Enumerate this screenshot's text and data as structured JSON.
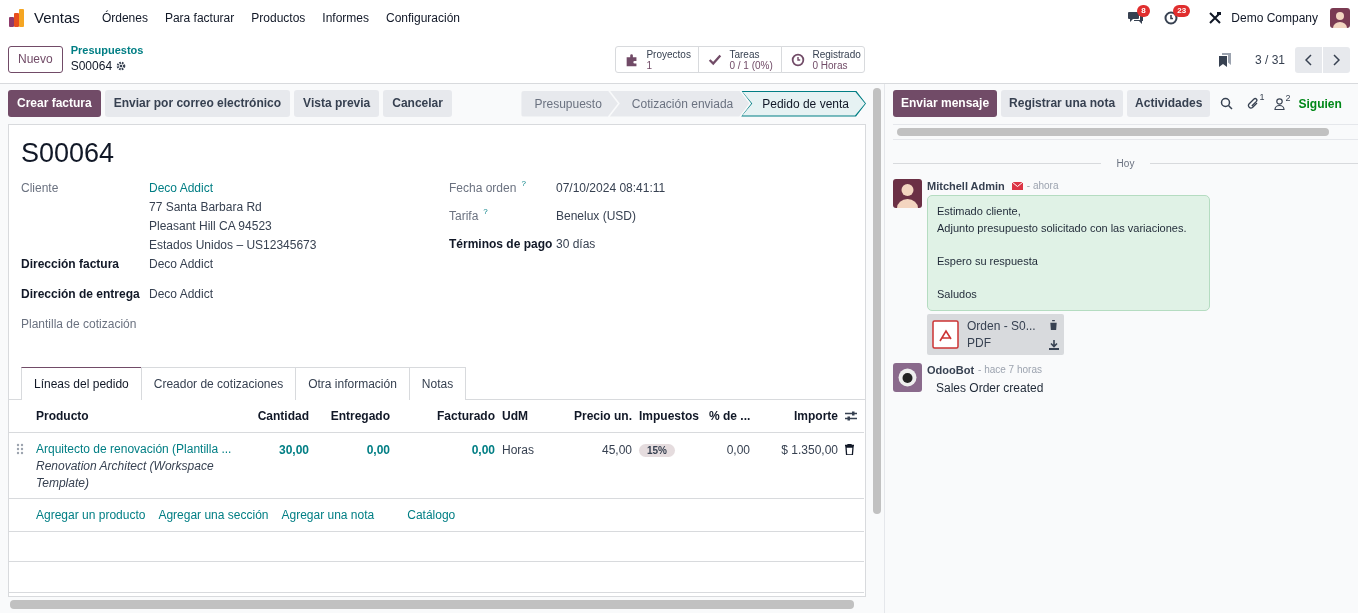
{
  "navbar": {
    "app": "Ventas",
    "menus": [
      "Órdenes",
      "Para facturar",
      "Productos",
      "Informes",
      "Configuración"
    ],
    "messages_badge": "8",
    "activities_badge": "23",
    "company": "Demo Company"
  },
  "control_panel": {
    "new_button": "Nuevo",
    "breadcrumb": "Presupuestos",
    "record": "S00064",
    "pager": "3 / 31",
    "smart_buttons": [
      {
        "kind": "projects",
        "label": "Proyectos",
        "value": "1"
      },
      {
        "kind": "tasks",
        "label": "Tareas",
        "value": "0 / 1 (0%)"
      },
      {
        "kind": "timesheet",
        "label": "Registrado",
        "value": "0 Horas"
      }
    ]
  },
  "actions": [
    {
      "label": "Crear factura",
      "primary": true
    },
    {
      "label": "Enviar por correo electrónico",
      "primary": false
    },
    {
      "label": "Vista previa",
      "primary": false
    },
    {
      "label": "Cancelar",
      "primary": false
    }
  ],
  "statusbar": [
    {
      "label": "Presupuesto",
      "selected": false
    },
    {
      "label": "Cotización enviada",
      "selected": false
    },
    {
      "label": "Pedido de venta",
      "selected": true
    }
  ],
  "form": {
    "title": "S00064",
    "left_fields": [
      {
        "label": "Cliente",
        "emphasized": false,
        "value": "Deco Addict",
        "link": true,
        "lines": [
          "77 Santa Barbara Rd",
          "Pleasant Hill CA 94523",
          "Estados Unidos – US12345673"
        ]
      },
      {
        "label": "Dirección factura",
        "emphasized": true,
        "value": "Deco Addict",
        "link": false
      },
      {
        "label": "Dirección de entrega",
        "emphasized": true,
        "value": "Deco Addict",
        "link": false
      },
      {
        "label": "Plantilla de cotización",
        "emphasized": false
      }
    ],
    "right_fields": [
      {
        "label": "Fecha orden",
        "emphasized": false,
        "help": "?",
        "value": "07/10/2024 08:41:11"
      },
      {
        "label": "Tarifa",
        "emphasized": false,
        "help": "?",
        "value": "Benelux (USD)"
      },
      {
        "label": "Términos de pago",
        "emphasized": true,
        "value": "30 días"
      }
    ]
  },
  "tabs": [
    {
      "label": "Líneas del pedido",
      "selected": true
    },
    {
      "label": "Creador de cotizaciones",
      "selected": false
    },
    {
      "label": "Otra información",
      "selected": false
    },
    {
      "label": "Notas",
      "selected": false
    }
  ],
  "order_lines": {
    "columns": [
      {
        "label": "Producto",
        "kind": "text"
      },
      {
        "label": "Cantidad",
        "kind": "number"
      },
      {
        "label": "Entregado",
        "kind": "number"
      },
      {
        "label": "Facturado",
        "kind": "number"
      },
      {
        "label": "UdM",
        "kind": "text"
      },
      {
        "label": "Precio un.",
        "kind": "number"
      },
      {
        "label": "Impuestos",
        "kind": "text"
      },
      {
        "label": "% de ...",
        "kind": "number"
      },
      {
        "label": "Importe",
        "kind": "number"
      }
    ],
    "rows": [
      {
        "product": "Arquitecto de renovación (Plantilla ...",
        "description": "Renovation Architect (Workspace Template)",
        "quantity": "30,00",
        "delivered": "0,00",
        "invoiced": "0,00",
        "uom": "Horas",
        "price": "45,00",
        "taxes": "15%",
        "discount": "0,00",
        "subtotal": "$ 1.350,00"
      }
    ],
    "add_links": [
      "Agregar un producto",
      "Agregar una sección",
      "Agregar una nota",
      "Catálogo"
    ]
  },
  "chatter": {
    "buttons": [
      {
        "label": "Enviar mensaje",
        "primary": true
      },
      {
        "label": "Registrar una nota",
        "primary": false
      },
      {
        "label": "Actividades",
        "primary": false
      }
    ],
    "attachments_count": "1",
    "followers_count": "2",
    "follow": "Siguien",
    "date_separator": "Hoy",
    "messages": [
      {
        "author": "Mitchell Admin",
        "kind": "person",
        "email": true,
        "time": "- ahora",
        "paragraphs": [
          "Estimado cliente,\nAdjunto presupuesto solicitado con las variaciones.",
          "Espero su respuesta",
          "Saludos"
        ],
        "attachment": {
          "name": "Orden - S0...",
          "type": "PDF"
        }
      },
      {
        "author": "OdooBot",
        "kind": "bot",
        "email": false,
        "time": "- hace 7 horas",
        "body": "Sales Order created"
      }
    ]
  }
}
